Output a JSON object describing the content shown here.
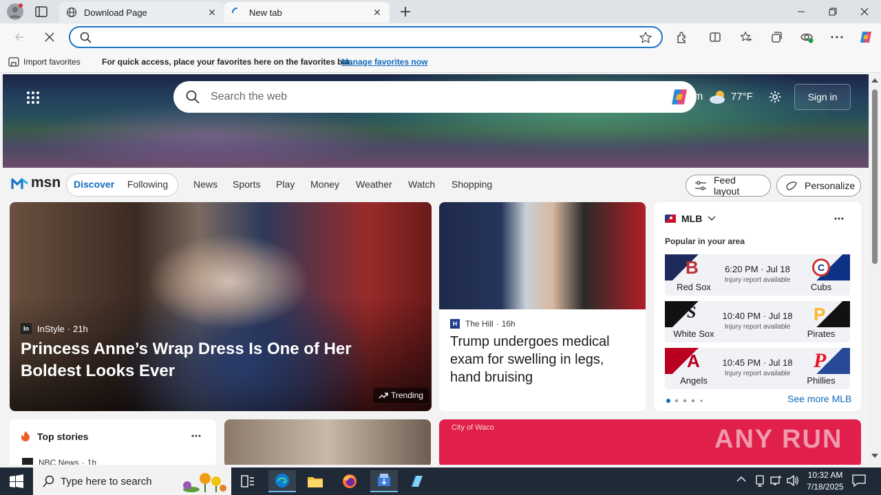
{
  "tabs": [
    {
      "title": "Download Page",
      "close": "✕"
    },
    {
      "title": "New tab",
      "close": "✕"
    }
  ],
  "favorites_bar": {
    "import_label": "Import favorites",
    "message": "For quick access, place your favorites here on the favorites bar.",
    "manage_link": "Manage favorites now"
  },
  "msn": {
    "search_placeholder": "Search the web",
    "weather_partial": "m",
    "temperature": "77°F",
    "sign_in": "Sign in",
    "logo": "msn",
    "pills": [
      "Discover",
      "Following"
    ],
    "nav_items": [
      "News",
      "Sports",
      "Play",
      "Money",
      "Weather",
      "Watch",
      "Shopping"
    ],
    "feed_layout": "Feed layout",
    "personalize": "Personalize"
  },
  "main_story": {
    "source": "InStyle",
    "source_abbr": "In",
    "age": "21h",
    "headline": "Princess Anne’s Wrap Dress Is One of Her Boldest Looks Ever",
    "badge": "Trending"
  },
  "second_story": {
    "source": "The Hill",
    "source_abbr": "H",
    "age": "16h",
    "headline": "Trump undergoes medical exam for swelling in legs, hand bruising"
  },
  "mlb": {
    "league": "MLB",
    "subtitle": "Popular in your area",
    "see_more": "See more MLB",
    "games": [
      {
        "time": "6:20 PM · Jul 18",
        "note": "Injury report available",
        "away": "Red Sox",
        "home": "Cubs",
        "away_color": "#1d2b5c",
        "home_color": "#0e3386",
        "away_logo": "B",
        "home_logo": "C"
      },
      {
        "time": "10:40 PM · Jul 18",
        "note": "Injury report available",
        "away": "White Sox",
        "home": "Pirates",
        "away_color": "#111111",
        "home_color": "#111111",
        "away_logo": "S",
        "home_logo": "P"
      },
      {
        "time": "10:45 PM · Jul 18",
        "note": "Injury report available",
        "away": "Angels",
        "home": "Phillies",
        "away_color": "#ba0021",
        "home_color": "#284898",
        "away_logo": "A",
        "home_logo": "P"
      }
    ]
  },
  "top_stories": {
    "title": "Top stories",
    "first_source": "NBC News",
    "first_age": "1h"
  },
  "row2_caption": "City of Waco",
  "watermark": "ANY RUN",
  "taskbar": {
    "search_placeholder": "Type here to search",
    "time": "10:32 AM",
    "date": "7/18/2025"
  },
  "colors": {
    "accent": "#1a73c9",
    "msn_blue": "#0f6cbd",
    "taskbar": "#1f2a36"
  }
}
